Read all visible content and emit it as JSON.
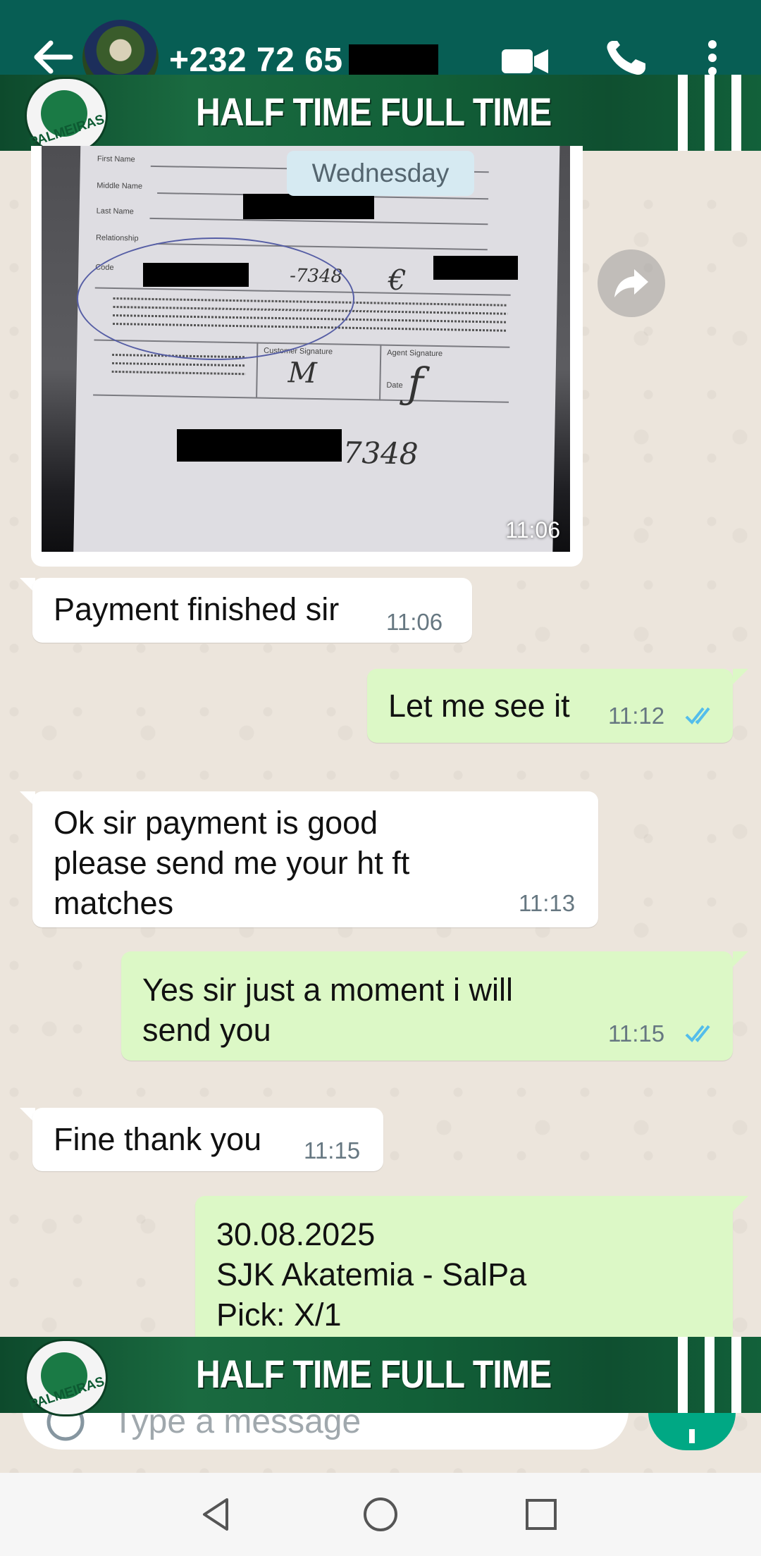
{
  "header": {
    "contact_name": "+232 72 65",
    "avatar": "contact-avatar",
    "icons": [
      "back-arrow-icon",
      "video-call-icon",
      "phone-icon",
      "more-vertical-icon"
    ],
    "color": "#075e54"
  },
  "banner": {
    "text": "HALF TIME FULL TIME",
    "logo_text": "PALMEIRAS"
  },
  "chat": {
    "date_separator": "Wednesday",
    "image_message": {
      "time": "11:06",
      "doc_fields": [
        "First Name",
        "Middle Name",
        "Last Name",
        "Relationship",
        "Code",
        "Customer Signature",
        "Agent Signature",
        "Date"
      ],
      "handwriting_code": "-7348",
      "handwriting_bottom": "7348"
    },
    "messages": [
      {
        "direction": "in",
        "text": "Payment finished sir",
        "time": "11:06"
      },
      {
        "direction": "out",
        "text": "Let me see it",
        "time": "11:12",
        "status": "read"
      },
      {
        "direction": "in",
        "text": "Ok sir payment is good\nplease send me your ht ft\nmatches",
        "time": "11:13"
      },
      {
        "direction": "out",
        "text": "Yes sir just a moment i will\nsend you",
        "time": "11:15",
        "status": "read"
      },
      {
        "direction": "in",
        "text": "Fine thank you",
        "time": "11:15"
      },
      {
        "direction": "out",
        "text": "30.08.2025\nSJK Akatemia - SalPa\nPick: X/1",
        "time": ""
      }
    ]
  },
  "composer": {
    "placeholder": "Type a message"
  },
  "colors": {
    "incoming_bubble": "#ffffff",
    "outgoing_bubble": "#dcf8c6",
    "read_ticks": "#53bdeb",
    "fab": "#00a884"
  }
}
